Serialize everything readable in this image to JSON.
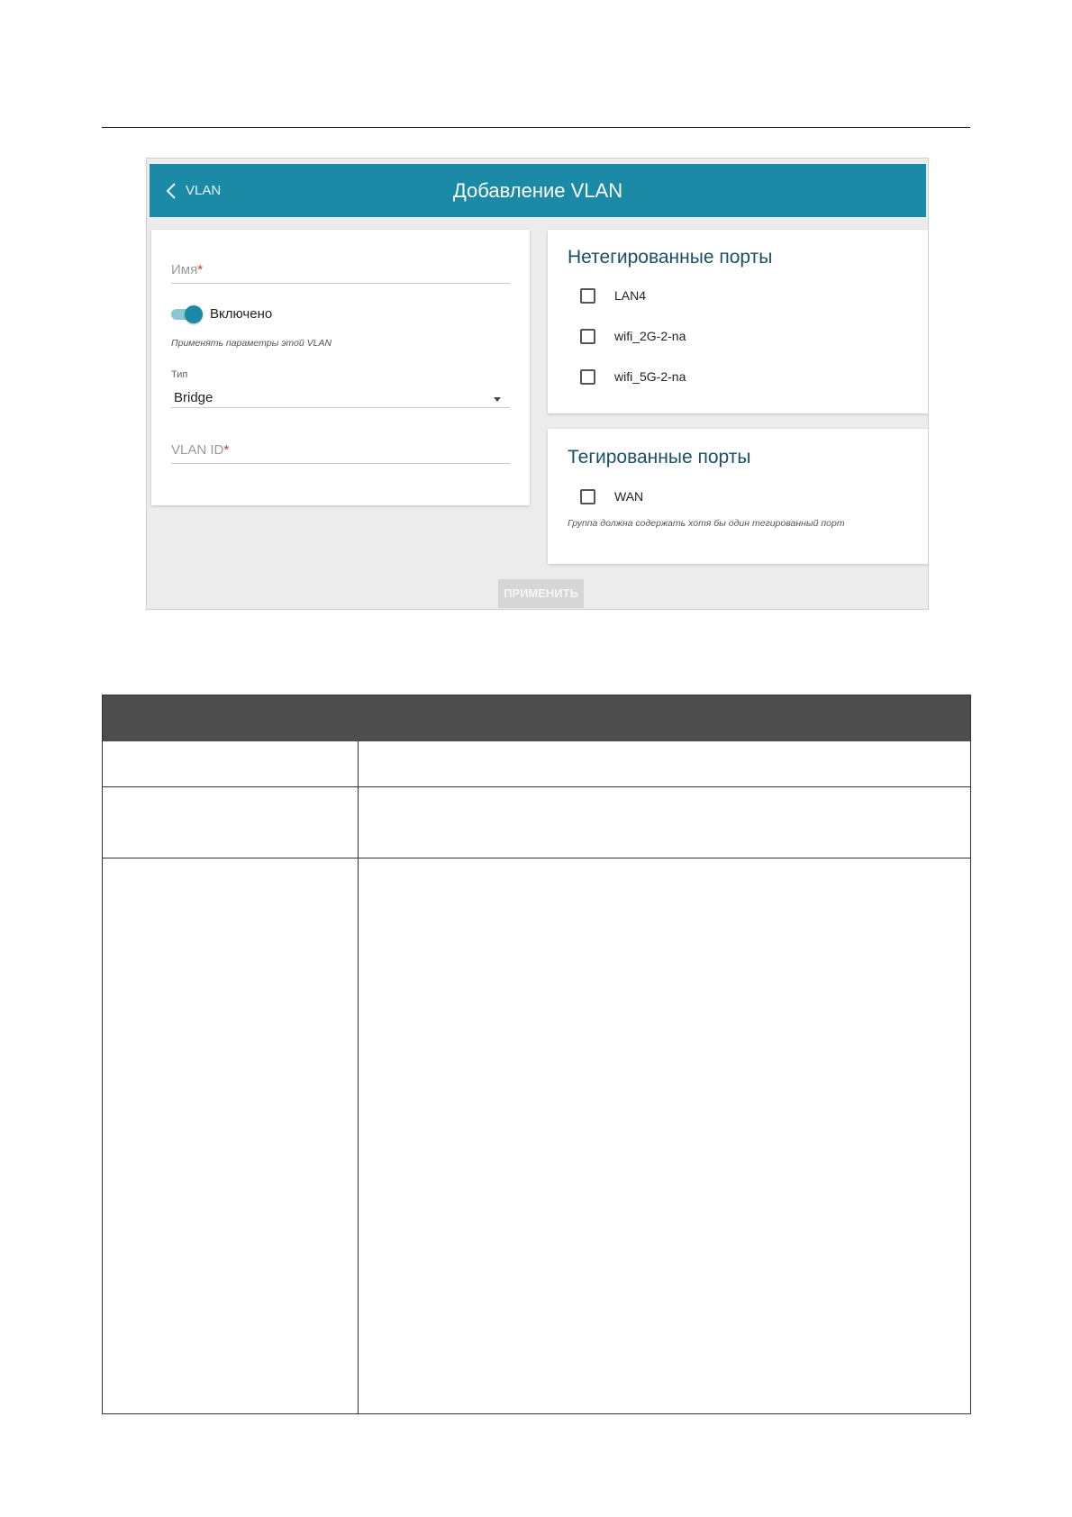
{
  "header": {
    "back_label": "VLAN",
    "title": "Добавление VLAN"
  },
  "form": {
    "name": {
      "label": "Имя",
      "required_mark": "*"
    },
    "enabled": {
      "label": "Включено",
      "on": true,
      "hint": "Применять параметры этой VLAN"
    },
    "type": {
      "label": "Тип",
      "value": "Bridge"
    },
    "vlan_id": {
      "label": "VLAN ID",
      "required_mark": "*"
    }
  },
  "untagged": {
    "title": "Нетегированные порты",
    "ports": [
      {
        "label": "LAN4",
        "checked": false
      },
      {
        "label": "wifi_2G-2-na",
        "checked": false
      },
      {
        "label": "wifi_5G-2-na",
        "checked": false
      }
    ]
  },
  "tagged": {
    "title": "Тегированные порты",
    "ports": [
      {
        "label": "WAN",
        "checked": false
      }
    ],
    "hint": "Группа должна содержать хотя бы один тегированный порт"
  },
  "apply_label": "ПРИМЕНИТЬ",
  "colors": {
    "header_bg": "#1b8aa6",
    "accent": "#1b8aa6",
    "card_title": "#1a4f66",
    "table_header": "#4d4d4d"
  }
}
